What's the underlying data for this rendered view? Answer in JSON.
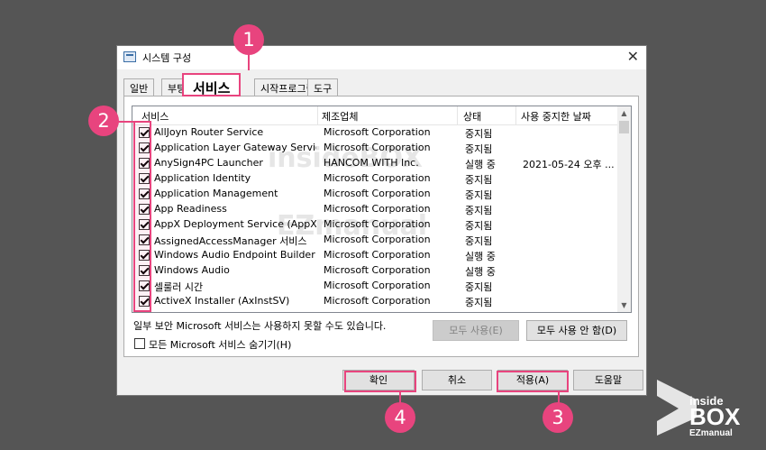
{
  "window": {
    "title": "시스템 구성",
    "close_glyph": "✕"
  },
  "tabs": [
    "일반",
    "부팅",
    "서비스",
    "시작프로그램",
    "도구"
  ],
  "columns": [
    "서비스",
    "제조업체",
    "상태",
    "사용 중지한 날짜"
  ],
  "rows": [
    {
      "service": "AllJoyn Router Service",
      "maker": "Microsoft Corporation",
      "status": "중지됨",
      "date": ""
    },
    {
      "service": "Application Layer Gateway Service",
      "maker": "Microsoft Corporation",
      "status": "중지됨",
      "date": ""
    },
    {
      "service": "AnySign4PC Launcher",
      "maker": "HANCOM WITH Inc.",
      "status": "실행 중",
      "date": "2021-05-24 오후 ..."
    },
    {
      "service": "Application Identity",
      "maker": "Microsoft Corporation",
      "status": "중지됨",
      "date": ""
    },
    {
      "service": "Application Management",
      "maker": "Microsoft Corporation",
      "status": "중지됨",
      "date": ""
    },
    {
      "service": "App Readiness",
      "maker": "Microsoft Corporation",
      "status": "중지됨",
      "date": ""
    },
    {
      "service": "AppX Deployment Service (AppXSV...",
      "maker": "Microsoft Corporation",
      "status": "중지됨",
      "date": ""
    },
    {
      "service": "AssignedAccessManager 서비스",
      "maker": "Microsoft Corporation",
      "status": "중지됨",
      "date": ""
    },
    {
      "service": "Windows Audio Endpoint Builder",
      "maker": "Microsoft Corporation",
      "status": "실행 중",
      "date": ""
    },
    {
      "service": "Windows Audio",
      "maker": "Microsoft Corporation",
      "status": "실행 중",
      "date": ""
    },
    {
      "service": "셀룰러 시간",
      "maker": "Microsoft Corporation",
      "status": "중지됨",
      "date": ""
    },
    {
      "service": "ActiveX Installer (AxInstSV)",
      "maker": "Microsoft Corporation",
      "status": "중지됨",
      "date": ""
    }
  ],
  "note": "일부 보안 Microsoft 서비스는 사용하지 못할 수도 있습니다.",
  "buttons": {
    "enable_all": "모두 사용(E)",
    "disable_all": "모두 사용 안 함(D)",
    "ok": "확인",
    "cancel": "취소",
    "apply": "적용(A)",
    "help": "도움말"
  },
  "hide_ms": "모든 Microsoft 서비스 숨기기(H)",
  "markers": [
    "1",
    "2",
    "3",
    "4"
  ],
  "watermark": {
    "line1": "insideBOX",
    "line2": "EZmanual"
  },
  "logo": {
    "top": "inside",
    "main": "BOX",
    "sub": "EZmanual"
  },
  "colors": {
    "accent": "#e8447e",
    "background": "#555555"
  }
}
